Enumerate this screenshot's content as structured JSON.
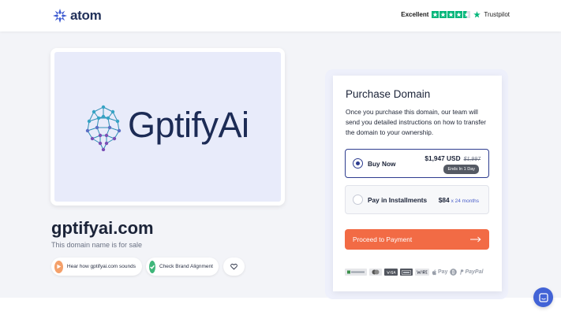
{
  "header": {
    "logo_text": "atom",
    "trust_label": "Excellent",
    "trust_brand": "Trustpilot",
    "trust_rating_stars": 4.5
  },
  "preview": {
    "brand_word": "GptifyAi",
    "brand_main": "Gptify",
    "brand_suffix": "Ai"
  },
  "domain": {
    "name": "gptifyai.com",
    "subtitle": "This domain name is for sale"
  },
  "actions": {
    "listen_label": "Hear how gptifyai.com sounds",
    "brand_check_label": "Check Brand Alignment"
  },
  "purchase": {
    "title": "Purchase Domain",
    "description": "Once you purchase this domain, our team will send you detailed instructions on how to transfer the domain to your ownership.",
    "buy_now": {
      "label": "Buy Now",
      "price": "$1,947 USD",
      "old_price": "$1,997",
      "badge": "Ends In 1 Day"
    },
    "installments": {
      "label": "Pay in Installments",
      "price": "$84",
      "suffix": "x 24 months"
    },
    "cta_label": "Proceed to Payment",
    "payment_methods": [
      "Escrow",
      "Mastercard",
      "Visa",
      "Amex",
      "Wire",
      "Apple Pay",
      "Bitcoin",
      "PayPal"
    ],
    "apple_pay_label": "Pay",
    "paypal_label": "PayPal"
  },
  "colors": {
    "accent": "#f26b45",
    "primary": "#2e3d8f",
    "trust_green": "#00b67a",
    "chat": "#4263d6"
  }
}
